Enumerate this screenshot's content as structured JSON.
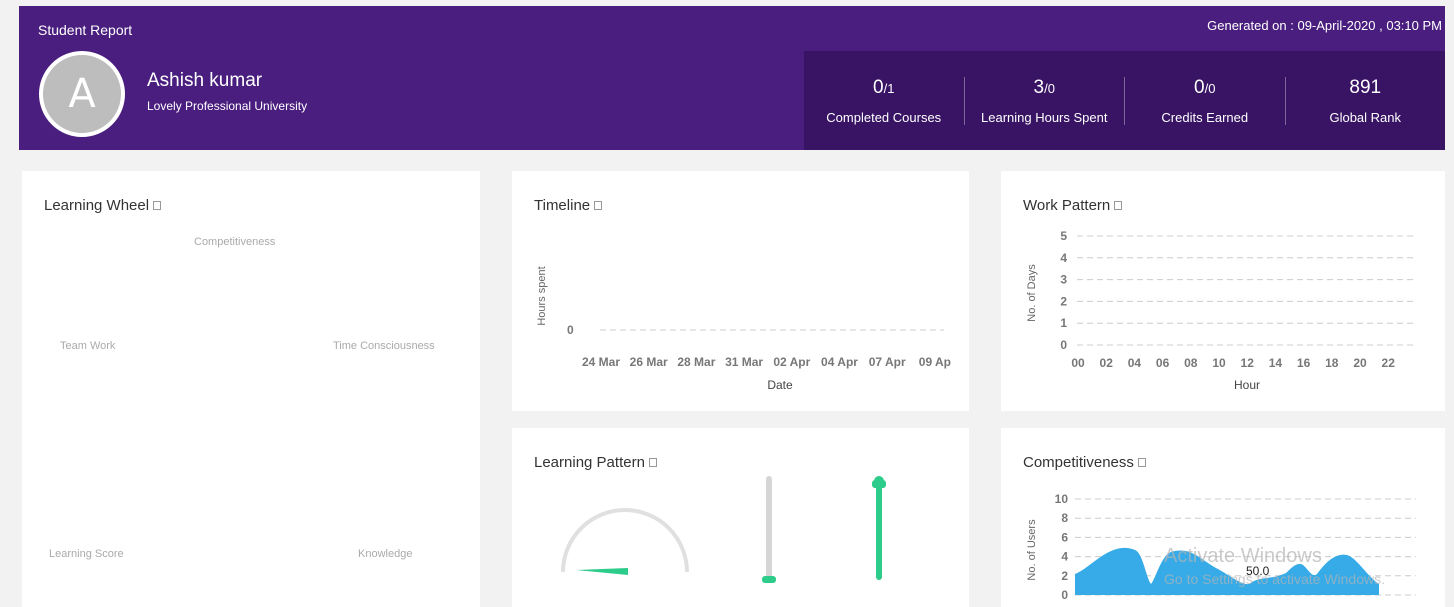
{
  "header": {
    "title": "Student Report",
    "generated": "Generated on : 09-April-2020 , 03:10 PM",
    "avatar_letter": "A",
    "name": "Ashish kumar",
    "university": "Lovely Professional University",
    "colors": {
      "primary": "#4a1e7e",
      "stats_bg": "#391465"
    }
  },
  "stats": [
    {
      "main": "0",
      "sub": "/1",
      "label": "Completed Courses"
    },
    {
      "main": "3",
      "sub": "/0",
      "label": "Learning Hours Spent"
    },
    {
      "main": "0",
      "sub": "/0",
      "label": "Credits Earned"
    },
    {
      "main": "891",
      "sub": "",
      "label": "Global Rank"
    }
  ],
  "learning_wheel": {
    "title": "Learning Wheel",
    "labels": [
      "Competitiveness",
      "Team Work",
      "Time Consciousness",
      "Learning Score",
      "Knowledge"
    ]
  },
  "timeline": {
    "title": "Timeline",
    "ylabel": "Hours spent",
    "xlabel": "Date",
    "y_tick": "0",
    "x_ticks": [
      "24 Mar",
      "26 Mar",
      "28 Mar",
      "31 Mar",
      "02 Apr",
      "04 Apr",
      "07 Apr",
      "09 Ap"
    ]
  },
  "work_pattern": {
    "title": "Work Pattern",
    "ylabel": "No. of Days",
    "xlabel": "Hour",
    "y_ticks": [
      "0",
      "1",
      "2",
      "3",
      "4",
      "5"
    ],
    "x_ticks": [
      "00",
      "02",
      "04",
      "06",
      "08",
      "10",
      "12",
      "14",
      "16",
      "18",
      "20",
      "22"
    ]
  },
  "learning_pattern": {
    "title": "Learning Pattern",
    "accent": "#2ecc8a"
  },
  "competitiveness": {
    "title": "Competitiveness",
    "ylabel": "No. of Users",
    "y_ticks": [
      "0",
      "2",
      "4",
      "6",
      "8",
      "10"
    ],
    "marker_label": "50.0",
    "fill": "#36abe8"
  },
  "watermark": {
    "line1": "Activate Windows",
    "line2": "Go to Settings to activate Windows."
  }
}
